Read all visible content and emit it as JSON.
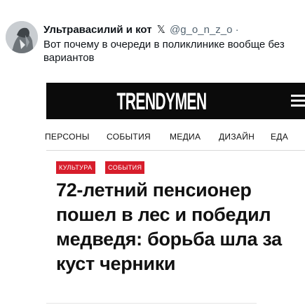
{
  "tweet": {
    "display_name": "Ультравасилий и кот",
    "x_glyph": "𝕏",
    "handle": "@g_o_n_z_o",
    "separator": "·",
    "text": "Вот почему в очереди в поликлинике вообще без вариантов",
    "avatar_icon": "avatar-drawing"
  },
  "site": {
    "logo": "TRENDYMEN",
    "menu_icon": "hamburger-menu-icon",
    "nav": [
      "ПЕРСОНЫ",
      "СОБЫТИЯ",
      "МЕДИА",
      "ДИЗАЙН",
      "ЕДА"
    ],
    "tags": [
      "КУЛЬТУРА",
      "СОБЫТИЯ"
    ],
    "headline": "72-летний пенсионер пошел в лес и победил медведя: борьба шла за куст черники",
    "colors": {
      "header_bg": "#0b0b0b",
      "tag_bg": "#d71d2b",
      "text": "#111111"
    }
  }
}
